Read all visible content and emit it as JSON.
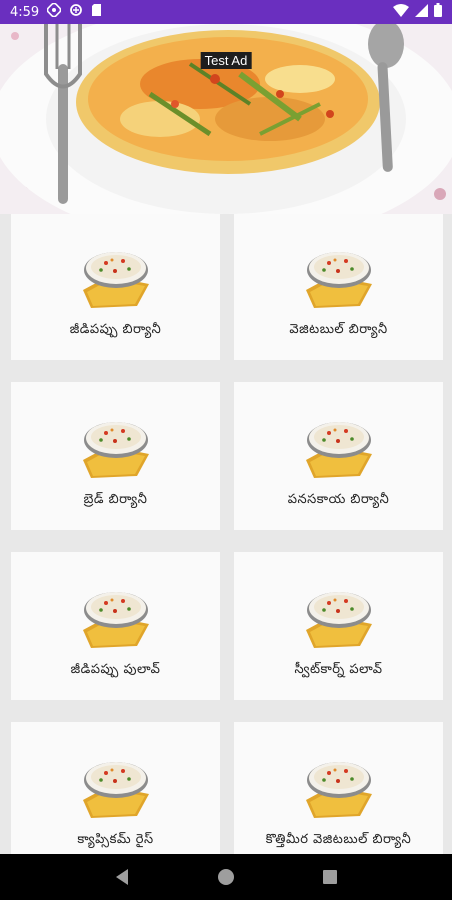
{
  "status_bar": {
    "time": "4:59",
    "icons": [
      "notification-icon",
      "data-saver-icon",
      "sd-card-icon",
      "wifi-icon",
      "signal-icon",
      "battery-icon"
    ]
  },
  "banner": {
    "image": "vegetable-biryani-plate-photo",
    "ad_label": "Test Ad"
  },
  "recipes": [
    {
      "label": "జీడిపప్పు బిర్యానీ",
      "image": "biryani-bowl-thumbnail"
    },
    {
      "label": "వెజిటబుల్ బిర్యానీ",
      "image": "biryani-bowl-thumbnail"
    },
    {
      "label": "బ్రెడ్ బిర్యానీ",
      "image": "biryani-bowl-thumbnail"
    },
    {
      "label": "పనసకాయ బిర్యానీ",
      "image": "biryani-bowl-thumbnail"
    },
    {
      "label": "జీడిపప్పు పులావ్",
      "image": "biryani-bowl-thumbnail"
    },
    {
      "label": "స్వీట్‌కార్న్ పలావ్",
      "image": "biryani-bowl-thumbnail"
    },
    {
      "label": "క్యాప్సికమ్ రైస్",
      "image": "biryani-bowl-thumbnail"
    },
    {
      "label": "కొత్తిమీర వెజిటబుల్ బిర్యానీ",
      "image": "biryani-bowl-thumbnail"
    }
  ],
  "nav_bar": {
    "buttons": [
      "back-icon",
      "home-icon",
      "recents-icon"
    ]
  },
  "colors": {
    "status_bar": "#6a2fbf",
    "background": "#e8e8e8",
    "tile": "#fafafa",
    "nav_bar": "#000000"
  }
}
